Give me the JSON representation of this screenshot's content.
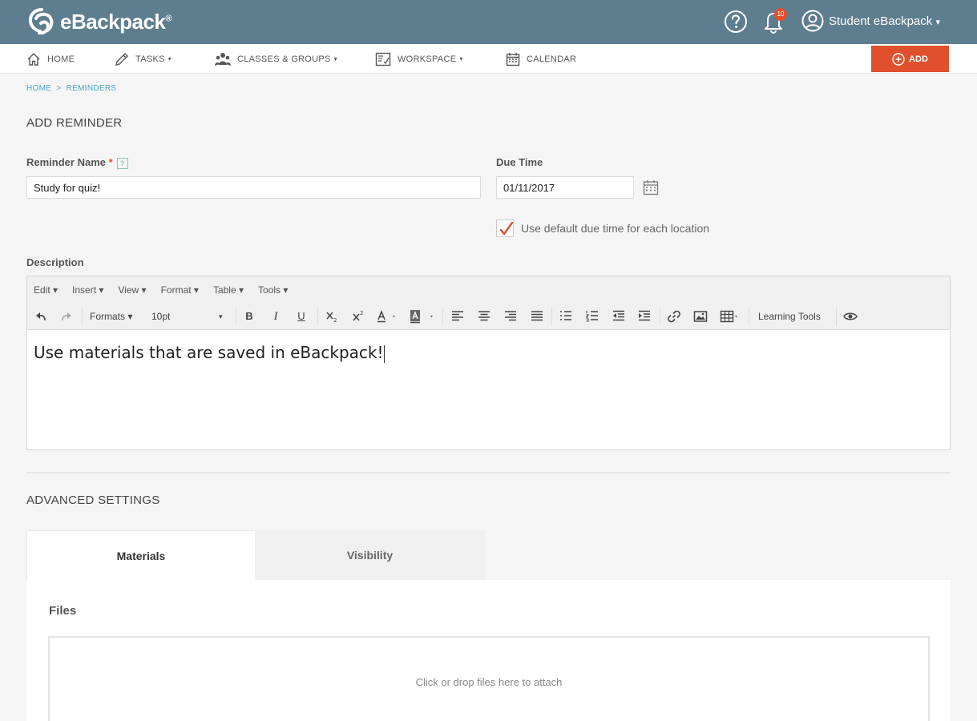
{
  "header": {
    "logo_text": "eBackpack",
    "logo_reg": "®",
    "notification_count": "10",
    "user_name": "Student eBackpack",
    "user_caret": "▾"
  },
  "nav": {
    "home": "HOME",
    "tasks": "TASKS",
    "classes": "CLASSES & GROUPS",
    "workspace": "WORKSPACE",
    "calendar": "CALENDAR",
    "add": "ADD",
    "caret": "▾"
  },
  "breadcrumb": "HOME  >  REMINDERS",
  "page_title": "ADD REMINDER",
  "form": {
    "name_label": "Reminder Name",
    "required_mark": "*",
    "help_mark": "?",
    "name_value": "Study for quiz!",
    "due_label": "Due Time",
    "due_value": "01/11/2017",
    "default_time_label": "Use default due time for each location",
    "default_time_checked": true,
    "description_label": "Description"
  },
  "editor": {
    "menus": [
      "Edit ▾",
      "Insert ▾",
      "View ▾",
      "Format ▾",
      "Table ▾",
      "Tools ▾"
    ],
    "formats": "Formats ▾",
    "font_size": "10pt",
    "font_size_caret": "▾",
    "bold": "B",
    "italic": "I",
    "underline": "U",
    "learning_tools": "Learning Tools",
    "content": "Use materials that are saved in eBackpack!"
  },
  "advanced": {
    "title": "ADVANCED SETTINGS",
    "tabs": [
      {
        "label": "Materials",
        "active": true
      },
      {
        "label": "Visibility",
        "active": false
      }
    ],
    "files_title": "Files",
    "drop_text": "Click or drop files here to attach"
  },
  "colors": {
    "header_bg": "#5e7d8f",
    "accent": "#e0502c",
    "link": "#4aa6c6"
  }
}
